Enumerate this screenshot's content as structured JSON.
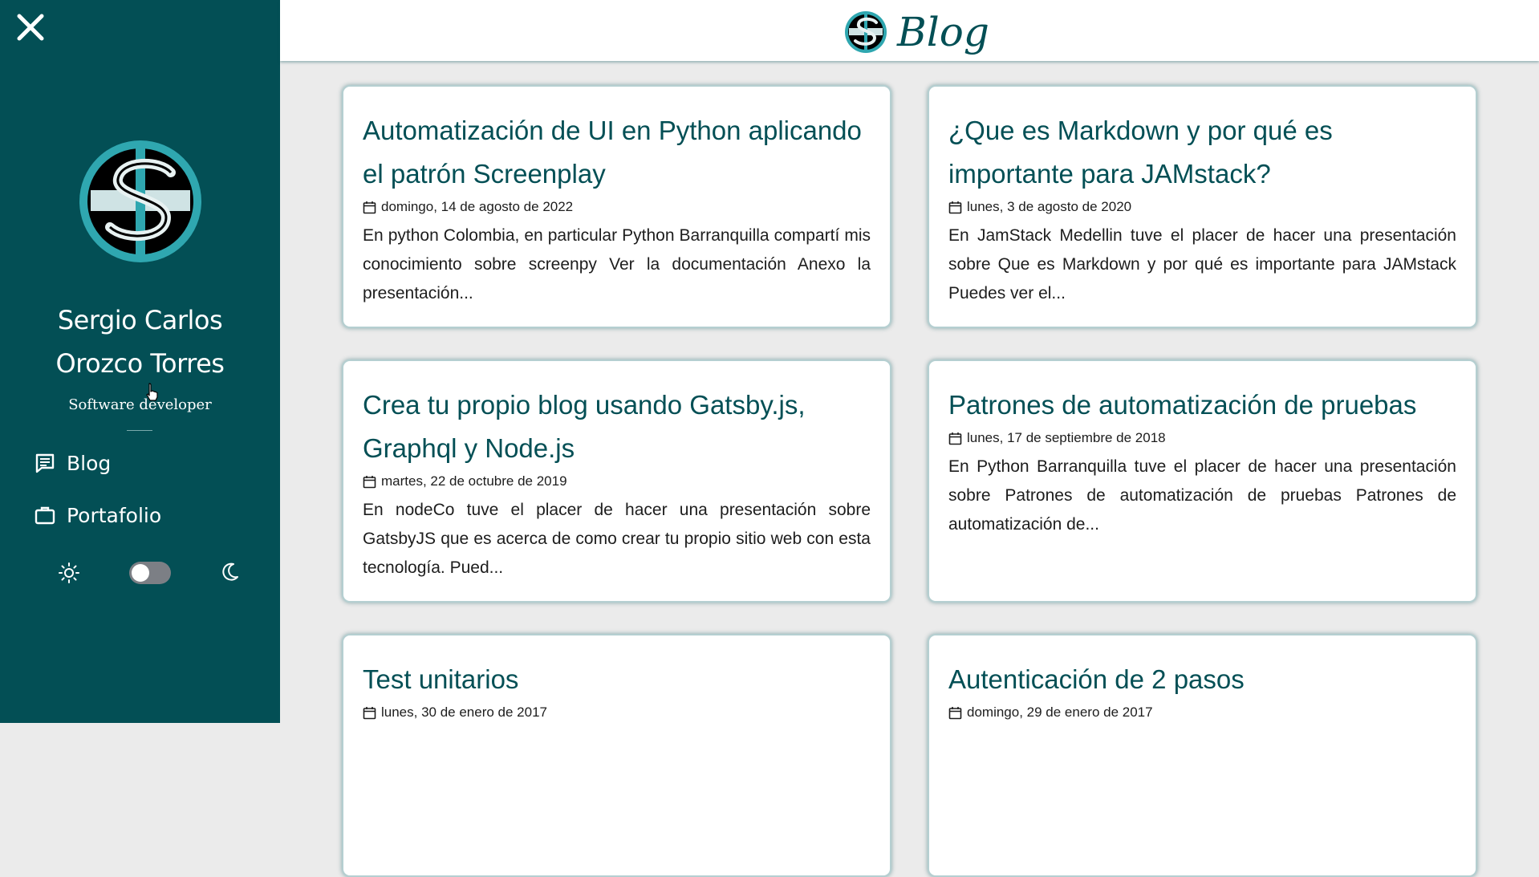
{
  "profile": {
    "name": "Sergio Carlos Orozco Torres",
    "role": "Software developer"
  },
  "nav": {
    "blog_label": "Blog",
    "portfolio_label": "Portafolio"
  },
  "theme_toggle": {
    "dark_mode": false
  },
  "header": {
    "title": "Blog"
  },
  "colors": {
    "primary": "#034f55",
    "accent": "#2fa7b0",
    "background": "#ebebeb"
  },
  "posts": [
    {
      "title": "Automatización de UI en Python aplicando el patrón Screenplay",
      "date": "domingo, 14 de agosto de 2022",
      "excerpt": "En python Colombia, en particular Python Barranquilla compartí mis conocimiento sobre screenpy Ver la documentación Anexo la presentación..."
    },
    {
      "title": "¿Que es Markdown y por qué es importante para JAMstack?",
      "date": "lunes, 3 de agosto de 2020",
      "excerpt": "En JamStack Medellin tuve el placer de hacer una presentación sobre Que es Markdown y por qué es importante para JAMstack Puedes ver el..."
    },
    {
      "title": "Crea tu propio blog usando Gatsby.js, Graphql y Node.js",
      "date": "martes, 22 de octubre de 2019",
      "excerpt": "En nodeCo tuve el placer de hacer una presentación sobre GatsbyJS que es acerca de como crear tu propio sitio web con esta tecnología. Pued..."
    },
    {
      "title": "Patrones de automatización de pruebas",
      "date": "lunes, 17 de septiembre de 2018",
      "excerpt": "En Python Barranquilla tuve el placer de hacer una presentación sobre Patrones de automatización de pruebas Patrones de automatización de..."
    },
    {
      "title": "Test unitarios",
      "date": "lunes, 30 de enero de 2017",
      "excerpt": ""
    },
    {
      "title": "Autenticación de 2 pasos",
      "date": "domingo, 29 de enero de 2017",
      "excerpt": ""
    }
  ]
}
